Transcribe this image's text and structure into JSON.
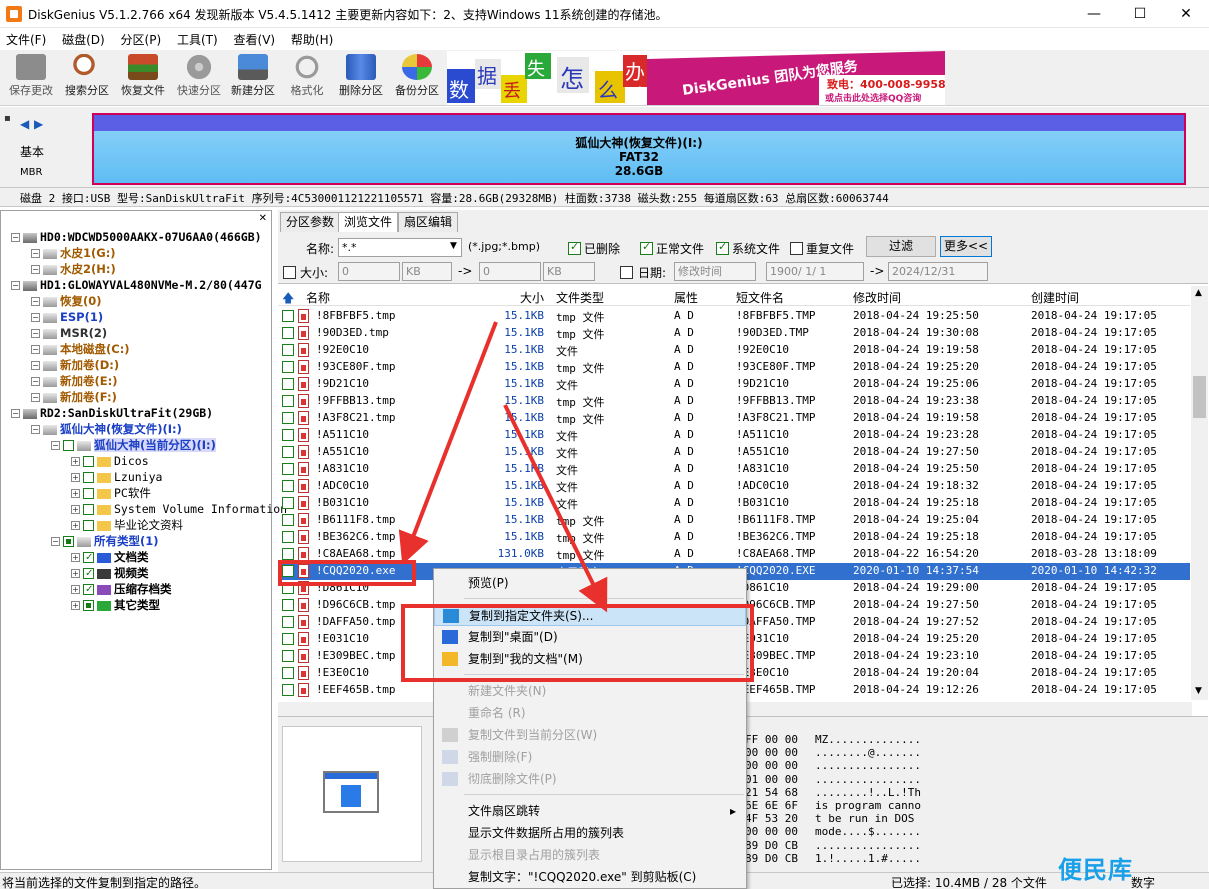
{
  "window": {
    "title": "DiskGenius V5.1.2.766 x64    发现新版本 V5.4.5.1412 主要更新内容如下：2、支持Windows 11系统创建的存储池。",
    "controls": [
      "—",
      "☐",
      "✕"
    ]
  },
  "menu": [
    "文件(F)",
    "磁盘(D)",
    "分区(P)",
    "工具(T)",
    "查看(V)",
    "帮助(H)"
  ],
  "toolbar": [
    {
      "label": "保存更改",
      "icon": "save-icon",
      "disabled": true
    },
    {
      "label": "搜索分区",
      "icon": "search-partition-icon",
      "disabled": false
    },
    {
      "label": "恢复文件",
      "icon": "recover-files-icon",
      "disabled": false
    },
    {
      "label": "快速分区",
      "icon": "quick-partition-icon",
      "disabled": true
    },
    {
      "label": "新建分区",
      "icon": "new-partition-icon",
      "disabled": false
    },
    {
      "label": "格式化",
      "icon": "format-icon",
      "disabled": true
    },
    {
      "label": "删除分区",
      "icon": "delete-partition-icon",
      "disabled": false
    },
    {
      "label": "备份分区",
      "icon": "backup-partition-icon",
      "disabled": false
    }
  ],
  "banner": {
    "tiles": [
      "数",
      "据",
      "丢",
      "失",
      "怎",
      "么",
      "办",
      "!"
    ],
    "slogan": "DiskGenius 团队为您服务",
    "phone": "致电：400-008-9958",
    "qq": "或点击此处选择QQ咨询"
  },
  "diskmap": {
    "type_label": "基本",
    "scheme_label": "MBR",
    "partition_name": "狐仙大神(恢复文件)(I:)",
    "partition_fs": "FAT32",
    "partition_size": "28.6GB"
  },
  "diskinfo": "磁盘 2 接口:USB  型号:SanDiskUltraFit  序列号:4C530001121221105571  容量:28.6GB(29328MB)  柱面数:3738  磁头数:255  每道扇区数:63  总扇区数:60063744",
  "tree": [
    {
      "label": "HD0:WDCWD5000AAKX-07U6AA0(466GB)",
      "indent": 0,
      "kind": "disk",
      "bold": true
    },
    {
      "label": "水皮1(G:)",
      "indent": 1,
      "kind": "partition",
      "color": "#a15a00"
    },
    {
      "label": "水皮2(H:)",
      "indent": 1,
      "kind": "partition",
      "color": "#a15a00"
    },
    {
      "label": "HD1:GLOWAYVAL480NVMe-M.2/80(447G",
      "indent": 0,
      "kind": "disk",
      "bold": true
    },
    {
      "label": "恢复(0)",
      "indent": 1,
      "kind": "partition",
      "color": "#a15a00"
    },
    {
      "label": "ESP(1)",
      "indent": 1,
      "kind": "partition",
      "color": "#1a3fc4"
    },
    {
      "label": "MSR(2)",
      "indent": 1,
      "kind": "partition",
      "color": "#333333"
    },
    {
      "label": "本地磁盘(C:)",
      "indent": 1,
      "kind": "partition",
      "color": "#a15a00"
    },
    {
      "label": "新加卷(D:)",
      "indent": 1,
      "kind": "partition",
      "color": "#a15a00"
    },
    {
      "label": "新加卷(E:)",
      "indent": 1,
      "kind": "partition",
      "color": "#a15a00"
    },
    {
      "label": "新加卷(F:)",
      "indent": 1,
      "kind": "partition",
      "color": "#a15a00"
    },
    {
      "label": "RD2:SanDiskUltraFit(29GB)",
      "indent": 0,
      "kind": "disk",
      "bold": true
    },
    {
      "label": "狐仙大神(恢复文件)(I:)",
      "indent": 1,
      "kind": "partition",
      "color": "#1a3fc4"
    },
    {
      "label": "狐仙大神(当前分区)(I:)",
      "indent": 2,
      "kind": "current",
      "color": "#1a3fc4"
    },
    {
      "label": "Dicos",
      "indent": 3,
      "kind": "folder",
      "color": "#000000"
    },
    {
      "label": "Lzuniya",
      "indent": 3,
      "kind": "folder",
      "color": "#000000"
    },
    {
      "label": "PC软件",
      "indent": 3,
      "kind": "folder",
      "color": "#000000"
    },
    {
      "label": "System Volume Information",
      "indent": 3,
      "kind": "folder",
      "color": "#000000"
    },
    {
      "label": "毕业论文资料",
      "indent": 3,
      "kind": "folder",
      "color": "#000000"
    },
    {
      "label": "所有类型(1)",
      "indent": 2,
      "kind": "alltypes",
      "color": "#1a3fc4"
    },
    {
      "label": "文档类",
      "indent": 3,
      "kind": "type-word",
      "color": "#000000"
    },
    {
      "label": "视频类",
      "indent": 3,
      "kind": "type-video",
      "color": "#000000"
    },
    {
      "label": "压缩存档类",
      "indent": 3,
      "kind": "type-zip",
      "color": "#000000"
    },
    {
      "label": "其它类型",
      "indent": 3,
      "kind": "type-other",
      "color": "#000000"
    }
  ],
  "tabs": [
    "分区参数",
    "浏览文件",
    "扇区编辑"
  ],
  "filter": {
    "name_label": "名称:",
    "name_value": "*.*",
    "name_hint": "(*.jpg;*.bmp)",
    "deleted": "已删除",
    "normal": "正常文件",
    "system": "系统文件",
    "duplicate": "重复文件",
    "filter_btn": "过滤",
    "more_btn": "更多<<",
    "size_label": "大小:",
    "size_from": "0",
    "size_from_unit": "KB",
    "arrow": "->",
    "size_to": "0",
    "size_to_unit": "KB",
    "date_label": "日期:",
    "date_type": "修改时间",
    "date_from": "1900/ 1/ 1",
    "date_to": "2024/12/31"
  },
  "columns": [
    "名称",
    "大小",
    "文件类型",
    "属性",
    "短文件名",
    "修改时间",
    "创建时间"
  ],
  "rows": [
    {
      "name": "!8FBFBF5.tmp",
      "size": "15.1KB",
      "type": "tmp 文件",
      "attr": "A D",
      "short": "!8FBFBF5.TMP",
      "mtime": "2018-04-24 19:25:50",
      "ctime": "2018-04-24 19:17:05"
    },
    {
      "name": "!90D3ED.tmp",
      "size": "15.1KB",
      "type": "tmp 文件",
      "attr": "A D",
      "short": "!90D3ED.TMP",
      "mtime": "2018-04-24 19:30:08",
      "ctime": "2018-04-24 19:17:05"
    },
    {
      "name": "!92E0C10",
      "size": "15.1KB",
      "type": "文件",
      "attr": "A D",
      "short": "!92E0C10",
      "mtime": "2018-04-24 19:19:58",
      "ctime": "2018-04-24 19:17:05"
    },
    {
      "name": "!93CE80F.tmp",
      "size": "15.1KB",
      "type": "tmp 文件",
      "attr": "A D",
      "short": "!93CE80F.TMP",
      "mtime": "2018-04-24 19:25:20",
      "ctime": "2018-04-24 19:17:05"
    },
    {
      "name": "!9D21C10",
      "size": "15.1KB",
      "type": "文件",
      "attr": "A D",
      "short": "!9D21C10",
      "mtime": "2018-04-24 19:25:06",
      "ctime": "2018-04-24 19:17:05"
    },
    {
      "name": "!9FFBB13.tmp",
      "size": "15.1KB",
      "type": "tmp 文件",
      "attr": "A D",
      "short": "!9FFBB13.TMP",
      "mtime": "2018-04-24 19:23:38",
      "ctime": "2018-04-24 19:17:05"
    },
    {
      "name": "!A3F8C21.tmp",
      "size": "15.1KB",
      "type": "tmp 文件",
      "attr": "A D",
      "short": "!A3F8C21.TMP",
      "mtime": "2018-04-24 19:19:58",
      "ctime": "2018-04-24 19:17:05"
    },
    {
      "name": "!A511C10",
      "size": "15.1KB",
      "type": "文件",
      "attr": "A D",
      "short": "!A511C10",
      "mtime": "2018-04-24 19:23:28",
      "ctime": "2018-04-24 19:17:05"
    },
    {
      "name": "!A551C10",
      "size": "15.1KB",
      "type": "文件",
      "attr": "A D",
      "short": "!A551C10",
      "mtime": "2018-04-24 19:27:50",
      "ctime": "2018-04-24 19:17:05"
    },
    {
      "name": "!A831C10",
      "size": "15.1KB",
      "type": "文件",
      "attr": "A D",
      "short": "!A831C10",
      "mtime": "2018-04-24 19:25:50",
      "ctime": "2018-04-24 19:17:05"
    },
    {
      "name": "!ADC0C10",
      "size": "15.1KB",
      "type": "文件",
      "attr": "A D",
      "short": "!ADC0C10",
      "mtime": "2018-04-24 19:18:32",
      "ctime": "2018-04-24 19:17:05"
    },
    {
      "name": "!B031C10",
      "size": "15.1KB",
      "type": "文件",
      "attr": "A D",
      "short": "!B031C10",
      "mtime": "2018-04-24 19:25:18",
      "ctime": "2018-04-24 19:17:05"
    },
    {
      "name": "!B6111F8.tmp",
      "size": "15.1KB",
      "type": "tmp 文件",
      "attr": "A D",
      "short": "!B6111F8.TMP",
      "mtime": "2018-04-24 19:25:04",
      "ctime": "2018-04-24 19:17:05"
    },
    {
      "name": "!BE362C6.tmp",
      "size": "15.1KB",
      "type": "tmp 文件",
      "attr": "A D",
      "short": "!BE362C6.TMP",
      "mtime": "2018-04-24 19:25:18",
      "ctime": "2018-04-24 19:17:05"
    },
    {
      "name": "!C8AEA68.tmp",
      "size": "131.0KB",
      "type": "tmp 文件",
      "attr": "A D",
      "short": "!C8AEA68.TMP",
      "mtime": "2018-04-22 16:54:20",
      "ctime": "2018-03-28 13:18:09"
    },
    {
      "name": "!CQQ2020.exe",
      "size": "",
      "type": "应用程序",
      "attr": "A D",
      "short": "!CQQ2020.EXE",
      "mtime": "2020-01-10 14:37:54",
      "ctime": "2020-01-10 14:42:32",
      "selected": true
    },
    {
      "name": "!D861C10",
      "size": "",
      "type": "",
      "attr": "",
      "short": "!D861C10",
      "mtime": "2018-04-24 19:29:00",
      "ctime": "2018-04-24 19:17:05"
    },
    {
      "name": "!D96C6CB.tmp",
      "size": "",
      "type": "",
      "attr": "",
      "short": "!D96C6CB.TMP",
      "mtime": "2018-04-24 19:27:50",
      "ctime": "2018-04-24 19:17:05"
    },
    {
      "name": "!DAFFA50.tmp",
      "size": "",
      "type": "",
      "attr": "",
      "short": "!DAFFA50.TMP",
      "mtime": "2018-04-24 19:27:52",
      "ctime": "2018-04-24 19:17:05"
    },
    {
      "name": "!E031C10",
      "size": "",
      "type": "",
      "attr": "",
      "short": "!E031C10",
      "mtime": "2018-04-24 19:25:20",
      "ctime": "2018-04-24 19:17:05"
    },
    {
      "name": "!E309BEC.tmp",
      "size": "",
      "type": "",
      "attr": "",
      "short": "!E309BEC.TMP",
      "mtime": "2018-04-24 19:23:10",
      "ctime": "2018-04-24 19:17:05"
    },
    {
      "name": "!E3E0C10",
      "size": "",
      "type": "",
      "attr": "",
      "short": "!E3E0C10",
      "mtime": "2018-04-24 19:20:04",
      "ctime": "2018-04-24 19:17:05"
    },
    {
      "name": "!EEF465B.tmp",
      "size": "",
      "type": "",
      "attr": "",
      "short": "!EEF465B.TMP",
      "mtime": "2018-04-24 19:12:26",
      "ctime": "2018-04-24 19:17:05"
    }
  ],
  "hex": [
    {
      "bytes": "FF 00 00",
      "ascii": "MZ.............."
    },
    {
      "bytes": "00 00 00",
      "ascii": "........@......."
    },
    {
      "bytes": "00 00 00",
      "ascii": "................"
    },
    {
      "bytes": "01 00 00",
      "ascii": "................"
    },
    {
      "bytes": "21 54 68",
      "ascii": "........!..L.!Th"
    },
    {
      "bytes": "6E 6E 6F",
      "ascii": "is program canno"
    },
    {
      "bytes": "4F 53 20",
      "ascii": "t be run in DOS "
    },
    {
      "bytes": "00 00 00",
      "ascii": "mode....$......."
    },
    {
      "bytes": "89 D0 CB",
      "ascii": "................"
    },
    {
      "bytes": "89 D0 CB",
      "ascii": "1.!.....1.#....."
    }
  ],
  "context_menu": [
    {
      "label": "预览(P)",
      "disabled": false,
      "icon": ""
    },
    {
      "sep": true
    },
    {
      "label": "复制到指定文件夹(S)...",
      "disabled": false,
      "icon": "copy-folder-icon",
      "highlight": true
    },
    {
      "label": "复制到\"桌面\"(D)",
      "disabled": false,
      "icon": "desktop-icon"
    },
    {
      "label": "复制到\"我的文档\"(M)",
      "disabled": false,
      "icon": "documents-folder-icon"
    },
    {
      "sep": true
    },
    {
      "label": "新建文件夹(N)",
      "disabled": true,
      "icon": ""
    },
    {
      "label": "重命名 (R)",
      "disabled": true,
      "icon": ""
    },
    {
      "label": "复制文件到当前分区(W)",
      "disabled": true,
      "icon": "copy-partition-icon"
    },
    {
      "label": "强制删除(F)",
      "disabled": true,
      "icon": "force-delete-icon"
    },
    {
      "label": "彻底删除文件(P)",
      "disabled": true,
      "icon": "wipe-icon"
    },
    {
      "sep": true
    },
    {
      "label": "文件扇区跳转",
      "disabled": false,
      "icon": "",
      "submenu": true
    },
    {
      "label": "显示文件数据所占用的簇列表",
      "disabled": false,
      "icon": ""
    },
    {
      "label": "显示根目录占用的簇列表",
      "disabled": true,
      "icon": ""
    },
    {
      "label": "复制文字：\"!CQQ2020.exe\" 到剪贴板(C)",
      "disabled": false,
      "icon": ""
    }
  ],
  "status": {
    "left": "将当前选择的文件复制到指定的路径。",
    "selected": "已选择: 10.4MB / 28 个文件",
    "mode": "数字"
  },
  "watermark": "便民库",
  "colors": {
    "accent_red": "#e8302c",
    "selection": "#3170cf",
    "partition_border": "#d0005a"
  }
}
